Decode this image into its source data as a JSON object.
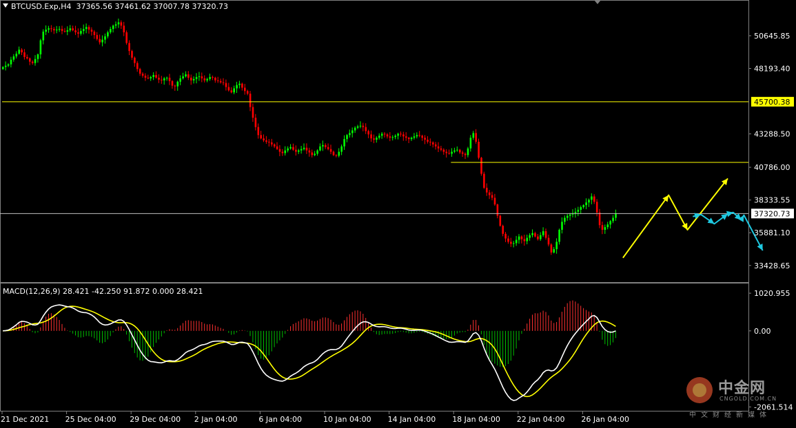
{
  "header": {
    "symbol": "BTCUSD.Exp,H4",
    "ohlc": "37365.56 37461.62 37007.78 37320.73"
  },
  "macd_header": "MACD(12,26,9) 28.421 -42.250 91.872 0.000 28.421",
  "colors": {
    "background": "#000000",
    "bull": "#00ff00",
    "bear": "#ff0000",
    "hline": "#ffff00",
    "price_line": "#c0c0c0",
    "hist_pos": "#ff3030",
    "hist_neg": "#00c000",
    "macd_line": "#ffffff",
    "signal_line": "#ffff00",
    "forecast_yellow": "#ffff00",
    "forecast_cyan": "#1ec8e0"
  },
  "chart_data": [
    {
      "type": "candlestick",
      "y_ticks": [
        "50645.85",
        "48193.40",
        "43288.50",
        "40786.00",
        "38333.55",
        "35881.10",
        "33428.65"
      ],
      "ylim": [
        32180,
        53220
      ],
      "x_ticks": [
        "21 Dec 2021",
        "25 Dec 04:00",
        "29 Dec 04:00",
        "2 Jan 04:00",
        "6 Jan 04:00",
        "10 Jan 04:00",
        "14 Jan 04:00",
        "18 Jan 04:00",
        "22 Jan 04:00",
        "26 Jan 04:00"
      ],
      "horizontal_lines": [
        {
          "price": 45700.38,
          "label": "45700.38",
          "from_bar": 0
        },
        {
          "price": 41150,
          "label": "",
          "from_bar": 167
        }
      ],
      "current_price": {
        "price": 37320.73,
        "label": "37320.73"
      },
      "close_series": [
        48300,
        48400,
        48500,
        48850,
        49100,
        49300,
        49600,
        49400,
        49050,
        48950,
        48700,
        48600,
        48900,
        49250,
        50300,
        50950,
        51100,
        51200,
        51150,
        51050,
        51100,
        51150,
        51000,
        50950,
        51050,
        51200,
        51050,
        50900,
        50800,
        51000,
        51150,
        51300,
        51100,
        50950,
        50700,
        50400,
        50150,
        50350,
        50600,
        50900,
        51150,
        51400,
        51500,
        51650,
        51400,
        50900,
        50100,
        49500,
        49000,
        48600,
        48150,
        47800,
        47650,
        47500,
        47450,
        47550,
        47700,
        47500,
        47350,
        47300,
        47450,
        47500,
        47250,
        46900,
        46850,
        47200,
        47450,
        47600,
        47750,
        47500,
        47300,
        47400,
        47550,
        47600,
        47450,
        47300,
        47400,
        47550,
        47500,
        47300,
        47250,
        47150,
        47100,
        46800,
        46550,
        46400,
        46700,
        46950,
        47050,
        46750,
        46500,
        46300,
        45300,
        44500,
        43800,
        43200,
        42950,
        42800,
        42700,
        42650,
        42500,
        42350,
        42150,
        41950,
        41850,
        42050,
        42200,
        42300,
        42100,
        41950,
        42050,
        42150,
        42250,
        42050,
        41900,
        41700,
        41800,
        42050,
        42350,
        42450,
        42300,
        42150,
        41950,
        41700,
        41650,
        41950,
        42350,
        42900,
        43200,
        43350,
        43550,
        43750,
        43850,
        43900,
        43800,
        43500,
        43250,
        42950,
        42850,
        43000,
        43150,
        43300,
        43250,
        43100,
        43000,
        43050,
        43150,
        43300,
        43250,
        43100,
        43000,
        42900,
        43000,
        43100,
        43200,
        43150,
        43000,
        42850,
        42700,
        42650,
        42500,
        42350,
        42200,
        42100,
        41950,
        41850,
        41800,
        41950,
        42050,
        42100,
        41900,
        41800,
        41700,
        42200,
        43000,
        43350,
        42700,
        41500,
        40300,
        39250,
        38900,
        38700,
        38500,
        38000,
        37150,
        36400,
        35800,
        35450,
        35200,
        35050,
        35100,
        35350,
        35600,
        35400,
        35250,
        35500,
        35700,
        35850,
        35600,
        35400,
        35700,
        36000,
        35500,
        35000,
        34400,
        34650,
        35200,
        36100,
        36700,
        37000,
        37150,
        37250,
        37350,
        37450,
        37600,
        37800,
        37950,
        38150,
        38350,
        38600,
        38200,
        37400,
        36450,
        36100,
        36300,
        36500,
        36750,
        37000,
        37320.73
      ]
    },
    {
      "type": "macd",
      "params": "12,26,9",
      "y_ticks": [
        "1020.955",
        "0.00",
        "-2061.514"
      ],
      "ylim": [
        -2185,
        1265
      ],
      "values": {
        "macd": 28.421,
        "signal": -42.25,
        "histogram": 91.872
      }
    }
  ],
  "forecast_arrows": {
    "yellow": [
      [
        231,
        34000
      ],
      [
        248,
        38700
      ],
      [
        255,
        36100
      ],
      [
        270,
        39950
      ]
    ],
    "cyan": [
      [
        257,
        37100
      ],
      [
        260,
        37250
      ],
      [
        265,
        36550
      ],
      [
        270,
        37300
      ],
      [
        272,
        37400
      ],
      [
        275,
        36850
      ],
      [
        276,
        37200
      ],
      [
        283,
        34550
      ]
    ]
  },
  "watermark": {
    "logo": "cngold-logo-icon",
    "cn_name": "中金网",
    "domain": "CNGOLD.COM.CN",
    "tagline": "中文财经新媒体"
  }
}
